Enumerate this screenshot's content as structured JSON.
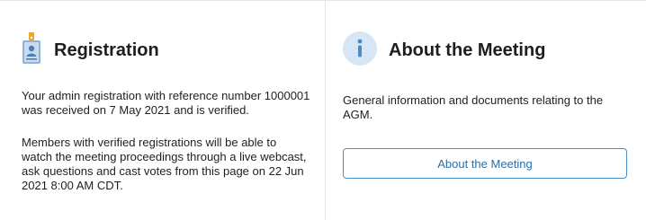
{
  "registration": {
    "title": "Registration",
    "icon": "id-badge-icon",
    "status_text": "Your admin registration with reference number 1000001 was received on 7 May 2021 and is verified.",
    "info_text": "Members with verified registrations will be able to watch the meeting proceedings through a live webcast, ask questions and cast votes from this page on 22 Jun 2021 8:00 AM CDT."
  },
  "about_meeting": {
    "title": "About the Meeting",
    "icon": "info-icon",
    "description": "General information and documents relating to the AGM.",
    "button_label": "About the Meeting"
  },
  "colors": {
    "accent": "#2b6fa6",
    "button_border": "#4a90c8",
    "info_circle": "#d6e6f4",
    "badge_gold": "#e8a530",
    "badge_blue": "#8fb3d9",
    "divider": "#e4e4e4"
  }
}
